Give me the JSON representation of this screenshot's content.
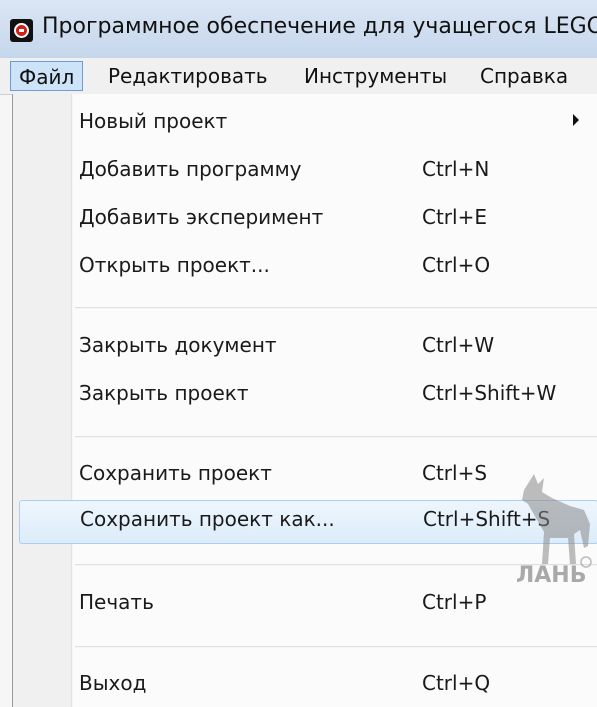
{
  "window": {
    "title": "Программное обеспечение для учащегося LEGO"
  },
  "menubar": {
    "items": [
      {
        "label": "Файл"
      },
      {
        "label": "Редактировать"
      },
      {
        "label": "Инструменты"
      },
      {
        "label": "Справка"
      }
    ]
  },
  "file_menu": {
    "items": [
      {
        "label": "Новый проект",
        "shortcut": ""
      },
      {
        "label": "Добавить программу",
        "shortcut": "Ctrl+N"
      },
      {
        "label": "Добавить эксперимент",
        "shortcut": "Ctrl+E"
      },
      {
        "label": "Открыть проект...",
        "shortcut": "Ctrl+O"
      },
      {
        "label": "Закрыть документ",
        "shortcut": "Ctrl+W"
      },
      {
        "label": "Закрыть проект",
        "shortcut": "Ctrl+Shift+W"
      },
      {
        "label": "Сохранить проект",
        "shortcut": "Ctrl+S"
      },
      {
        "label": "Сохранить проект как...",
        "shortcut": "Ctrl+Shift+S"
      },
      {
        "label": "Печать",
        "shortcut": "Ctrl+P"
      },
      {
        "label": "Выход",
        "shortcut": "Ctrl+Q"
      }
    ]
  },
  "icons": {
    "app": "lego-app-icon",
    "submenu": "submenu-arrow-icon",
    "watermark": "deer-logo"
  },
  "watermark": {
    "text": "ЛАНЬ"
  }
}
